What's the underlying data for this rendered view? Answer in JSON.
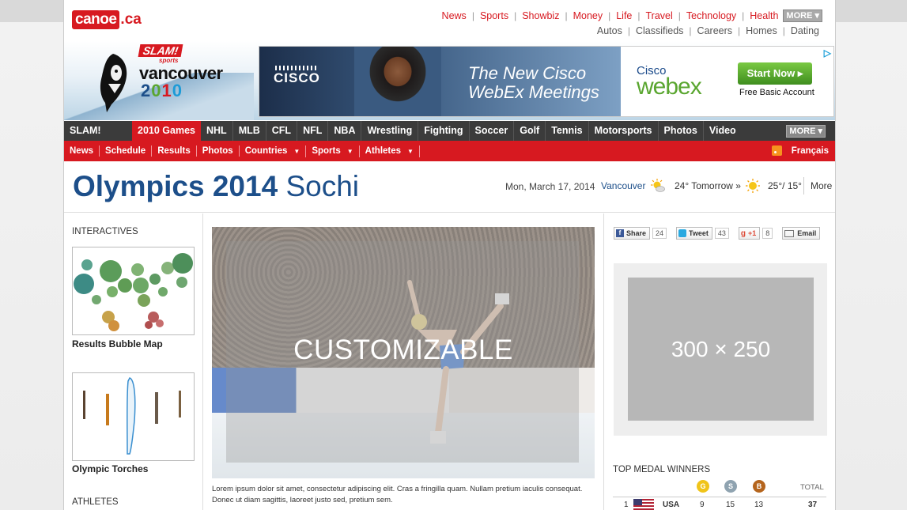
{
  "header": {
    "logo_main": "canoe",
    "logo_tld": ".ca",
    "primary_nav": [
      "News",
      "Sports",
      "Showbiz",
      "Money",
      "Life",
      "Travel",
      "Technology",
      "Health"
    ],
    "more_label": "MORE",
    "secondary_nav": [
      "Autos",
      "Classifieds",
      "Careers",
      "Homes",
      "Dating"
    ]
  },
  "banner": {
    "slam_label": "SLAM!",
    "slam_sub": "sports",
    "vancouver": "vancouver",
    "year": "2010",
    "ad": {
      "brand": "CISCO",
      "headline_1": "The New Cisco",
      "headline_2": "WebEx Meetings",
      "cisco_small": "Cisco",
      "webex": "webex",
      "cta": "Start Now",
      "sub": "Free Basic Account"
    }
  },
  "sport_nav": {
    "items": [
      "SLAM!",
      "2010 Games",
      "NHL",
      "MLB",
      "CFL",
      "NFL",
      "NBA",
      "Wrestling",
      "Fighting",
      "Soccer",
      "Golf",
      "Tennis",
      "Motorsports",
      "Photos",
      "Video"
    ],
    "active": "2010 Games",
    "more_label": "MORE"
  },
  "sub_nav": {
    "items": [
      {
        "label": "News",
        "dropdown": false
      },
      {
        "label": "Schedule",
        "dropdown": false
      },
      {
        "label": "Results",
        "dropdown": false
      },
      {
        "label": "Photos",
        "dropdown": false
      },
      {
        "label": "Countries",
        "dropdown": true
      },
      {
        "label": "Sports",
        "dropdown": true
      },
      {
        "label": "Athletes",
        "dropdown": true
      }
    ],
    "language": "Français"
  },
  "page": {
    "title_bold": "Olympics 2014",
    "title_light": "Sochi",
    "date": "Mon, March 17, 2014",
    "city": "Vancouver",
    "tomorrow": "24° Tomorrow »",
    "temps": "25°/ 15°",
    "more": "More"
  },
  "left": {
    "interactives_head": "INTERACTIVES",
    "bubble_caption": "Results Bubble Map",
    "torches_caption": "Olympic Torches",
    "athletes_head": "ATHLETES"
  },
  "main": {
    "hero_label": "CUSTOMIZABLE",
    "caption_1": "Lorem ipsum dolor sit amet, consectetur adipiscing elit. Cras a fringilla quam. Nullam pretium iaculis consequat.",
    "caption_2": "Donec ut diam sagittis, laoreet justo sed, pretium sem."
  },
  "right": {
    "share": [
      {
        "label": "Share",
        "count": "24"
      },
      {
        "label": "Tweet",
        "count": "43"
      },
      {
        "label": "+1",
        "count": "8"
      },
      {
        "label": "Email",
        "count": ""
      }
    ],
    "ad_size": "300 × 250",
    "medals_head": "TOP MEDAL WINNERS",
    "medal_letters": [
      "G",
      "S",
      "B"
    ],
    "total_label": "TOTAL",
    "rows": [
      {
        "rank": "1",
        "country": "USA",
        "gold": "9",
        "silver": "15",
        "bronze": "13",
        "total": "37"
      }
    ]
  },
  "colors": {
    "brand_red": "#d71920",
    "title_blue": "#1d4f8a",
    "gold": "#f0c419",
    "silver": "#8fa3b0",
    "bronze": "#b5651d"
  }
}
